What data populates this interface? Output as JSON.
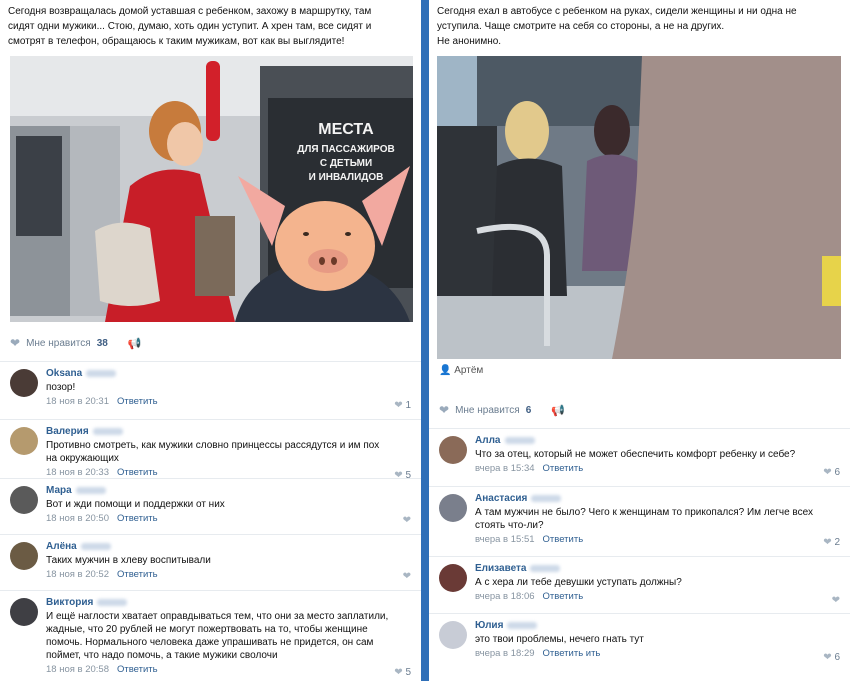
{
  "left": {
    "post_text": [
      "Сегодня возвращалась домой уставшая с ребенком, захожу в маршрутку, там",
      "сидят одни мужики... Стою, думаю, хоть один уступит. А хрен там, все сидят и",
      "смотрят в телефон, обращаюсь к таким мужикам, вот как вы выглядите!"
    ],
    "photo_sign": [
      "МЕСТА",
      "ДЛЯ ПАССАЖИРОВ",
      "С ДЕТЬМИ",
      "И ИНВАЛИДОВ"
    ],
    "likes_label": "Мне нравится",
    "likes_count": "38",
    "comments": [
      {
        "name": "Oksana",
        "text": [
          "позор!"
        ],
        "time": "18 ноя в 20:31",
        "reply": "Ответить",
        "likes": "1",
        "avatar_color": "#4a3b36"
      },
      {
        "name": "Валерия",
        "text": [
          "Противно смотреть, как мужики словно принцессы рассядутся и им пох",
          "на окружающих"
        ],
        "time": "18 ноя в 20:33",
        "reply": "Ответить",
        "likes": "5",
        "avatar_color": "#b59a6e"
      },
      {
        "name": "Мара",
        "text": [
          "Вот и жди помощи и поддержки от них"
        ],
        "time": "18 ноя в 20:50",
        "reply": "Ответить",
        "likes": "",
        "avatar_color": "#5a5a5a"
      },
      {
        "name": "Алёна",
        "text": [
          "Таких мужчин в хлеву воспитывали"
        ],
        "time": "18 ноя в 20:52",
        "reply": "Ответить",
        "likes": "",
        "avatar_color": "#6b5b44"
      },
      {
        "name": "Виктория",
        "text": [
          "И ещё наглости хватает оправдываться тем, что они за место заплатили,",
          "жадные, что 20 рублей не могут пожертвовать на то, чтобы женщине",
          "помочь. Нормального человека даже упрашивать не придется, он сам",
          "поймет, что надо помочь, а такие мужики сволочи"
        ],
        "time": "18 ноя в 20:58",
        "reply": "Ответить",
        "likes": "5",
        "avatar_color": "#3f3f44"
      }
    ]
  },
  "right": {
    "post_text": [
      "Сегодня ехал в автобусе с ребенком на руках, сидели женщины и ни одна не",
      "уступила. Чаще смотрите на себя со стороны, а не на других.",
      "Не анонимно."
    ],
    "author": "Артём",
    "likes_label": "Мне нравится",
    "likes_count": "6",
    "comments": [
      {
        "name": "Алла",
        "text": [
          "Что за отец, который не может обеспечить комфорт ребенку и себе?"
        ],
        "time": "вчера в 15:34",
        "reply": "Ответить",
        "likes": "6",
        "avatar_color": "#8a6a58"
      },
      {
        "name": "Анастасия",
        "text": [
          "А там мужчин не было? Чего к женщинам то прикопался? Им легче всех",
          "стоять что-ли?"
        ],
        "time": "вчера в 15:51",
        "reply": "Ответить",
        "likes": "2",
        "avatar_color": "#7a7f8c"
      },
      {
        "name": "Елизавета",
        "text": [
          "А с хера ли тебе девушки уступать должны?"
        ],
        "time": "вчера в 18:06",
        "reply": "Ответить",
        "likes": "",
        "avatar_color": "#6a3a36"
      },
      {
        "name": "Юлия",
        "text": [
          "это твои проблемы, нечего гнать тут"
        ],
        "time": "вчера в 18:29",
        "reply": "Ответить ить",
        "likes": "6",
        "avatar_color": "#c8ccd6"
      }
    ]
  }
}
